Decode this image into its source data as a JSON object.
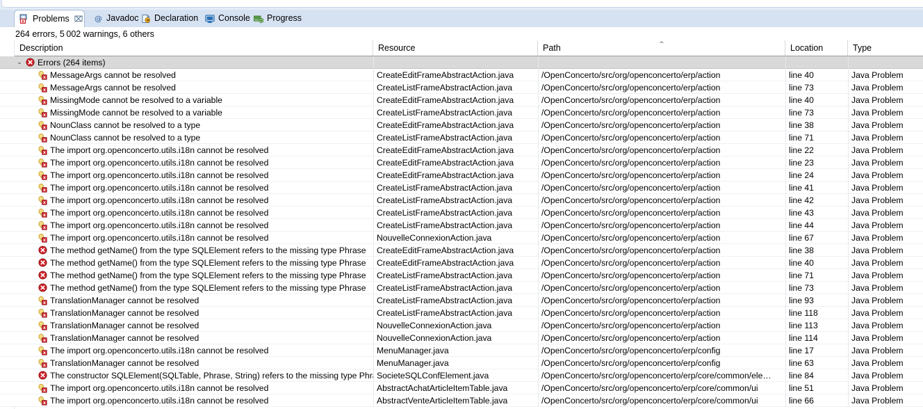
{
  "window": {
    "view_tabs": [
      {
        "label": "Problems",
        "icon": "problems-view-icon",
        "active": true,
        "close": "⌧"
      },
      {
        "label": "Javadoc",
        "icon": "javadoc-icon",
        "active": false
      },
      {
        "label": "Declaration",
        "icon": "declaration-icon",
        "active": false
      },
      {
        "label": "Console",
        "icon": "console-icon",
        "active": false
      },
      {
        "label": "Progress",
        "icon": "progress-icon",
        "active": false
      }
    ],
    "summary": "264 errors, 5 002 warnings, 6 others"
  },
  "table": {
    "columns": [
      {
        "key": "description",
        "label": "Description",
        "sorted": false
      },
      {
        "key": "resource",
        "label": "Resource",
        "sorted": false
      },
      {
        "key": "path",
        "label": "Path",
        "sorted": true,
        "sort_dir": "asc"
      },
      {
        "key": "location",
        "label": "Location",
        "sorted": false
      },
      {
        "key": "type",
        "label": "Type",
        "sorted": false
      }
    ],
    "group": {
      "label": "Errors (264 items)",
      "expanded": true,
      "twisty": "⌄",
      "icon": "error-icon"
    },
    "rows": [
      {
        "icon": "quickfix-error-icon",
        "description": "MessageArgs cannot be resolved",
        "resource": "CreateEditFrameAbstractAction.java",
        "path": "/OpenConcerto/src/org/openconcerto/erp/action",
        "location": "line 40",
        "type": "Java Problem"
      },
      {
        "icon": "quickfix-error-icon",
        "description": "MessageArgs cannot be resolved",
        "resource": "CreateListFrameAbstractAction.java",
        "path": "/OpenConcerto/src/org/openconcerto/erp/action",
        "location": "line 73",
        "type": "Java Problem"
      },
      {
        "icon": "quickfix-error-icon",
        "description": "MissingMode cannot be resolved to a variable",
        "resource": "CreateEditFrameAbstractAction.java",
        "path": "/OpenConcerto/src/org/openconcerto/erp/action",
        "location": "line 40",
        "type": "Java Problem"
      },
      {
        "icon": "quickfix-error-icon",
        "description": "MissingMode cannot be resolved to a variable",
        "resource": "CreateListFrameAbstractAction.java",
        "path": "/OpenConcerto/src/org/openconcerto/erp/action",
        "location": "line 73",
        "type": "Java Problem"
      },
      {
        "icon": "quickfix-error-icon",
        "description": "NounClass cannot be resolved to a type",
        "resource": "CreateEditFrameAbstractAction.java",
        "path": "/OpenConcerto/src/org/openconcerto/erp/action",
        "location": "line 38",
        "type": "Java Problem"
      },
      {
        "icon": "quickfix-error-icon",
        "description": "NounClass cannot be resolved to a type",
        "resource": "CreateListFrameAbstractAction.java",
        "path": "/OpenConcerto/src/org/openconcerto/erp/action",
        "location": "line 71",
        "type": "Java Problem"
      },
      {
        "icon": "quickfix-error-icon",
        "description": "The import org.openconcerto.utils.i18n cannot be resolved",
        "resource": "CreateEditFrameAbstractAction.java",
        "path": "/OpenConcerto/src/org/openconcerto/erp/action",
        "location": "line 22",
        "type": "Java Problem"
      },
      {
        "icon": "quickfix-error-icon",
        "description": "The import org.openconcerto.utils.i18n cannot be resolved",
        "resource": "CreateEditFrameAbstractAction.java",
        "path": "/OpenConcerto/src/org/openconcerto/erp/action",
        "location": "line 23",
        "type": "Java Problem"
      },
      {
        "icon": "quickfix-error-icon",
        "description": "The import org.openconcerto.utils.i18n cannot be resolved",
        "resource": "CreateEditFrameAbstractAction.java",
        "path": "/OpenConcerto/src/org/openconcerto/erp/action",
        "location": "line 24",
        "type": "Java Problem"
      },
      {
        "icon": "quickfix-error-icon",
        "description": "The import org.openconcerto.utils.i18n cannot be resolved",
        "resource": "CreateListFrameAbstractAction.java",
        "path": "/OpenConcerto/src/org/openconcerto/erp/action",
        "location": "line 41",
        "type": "Java Problem"
      },
      {
        "icon": "quickfix-error-icon",
        "description": "The import org.openconcerto.utils.i18n cannot be resolved",
        "resource": "CreateListFrameAbstractAction.java",
        "path": "/OpenConcerto/src/org/openconcerto/erp/action",
        "location": "line 42",
        "type": "Java Problem"
      },
      {
        "icon": "quickfix-error-icon",
        "description": "The import org.openconcerto.utils.i18n cannot be resolved",
        "resource": "CreateListFrameAbstractAction.java",
        "path": "/OpenConcerto/src/org/openconcerto/erp/action",
        "location": "line 43",
        "type": "Java Problem"
      },
      {
        "icon": "quickfix-error-icon",
        "description": "The import org.openconcerto.utils.i18n cannot be resolved",
        "resource": "CreateListFrameAbstractAction.java",
        "path": "/OpenConcerto/src/org/openconcerto/erp/action",
        "location": "line 44",
        "type": "Java Problem"
      },
      {
        "icon": "quickfix-error-icon",
        "description": "The import org.openconcerto.utils.i18n cannot be resolved",
        "resource": "NouvelleConnexionAction.java",
        "path": "/OpenConcerto/src/org/openconcerto/erp/action",
        "location": "line 67",
        "type": "Java Problem"
      },
      {
        "icon": "error-icon",
        "description": "The method getName() from the type SQLElement refers to the missing type Phrase",
        "resource": "CreateEditFrameAbstractAction.java",
        "path": "/OpenConcerto/src/org/openconcerto/erp/action",
        "location": "line 38",
        "type": "Java Problem"
      },
      {
        "icon": "error-icon",
        "description": "The method getName() from the type SQLElement refers to the missing type Phrase",
        "resource": "CreateEditFrameAbstractAction.java",
        "path": "/OpenConcerto/src/org/openconcerto/erp/action",
        "location": "line 40",
        "type": "Java Problem"
      },
      {
        "icon": "error-icon",
        "description": "The method getName() from the type SQLElement refers to the missing type Phrase",
        "resource": "CreateListFrameAbstractAction.java",
        "path": "/OpenConcerto/src/org/openconcerto/erp/action",
        "location": "line 71",
        "type": "Java Problem"
      },
      {
        "icon": "error-icon",
        "description": "The method getName() from the type SQLElement refers to the missing type Phrase",
        "resource": "CreateListFrameAbstractAction.java",
        "path": "/OpenConcerto/src/org/openconcerto/erp/action",
        "location": "line 73",
        "type": "Java Problem"
      },
      {
        "icon": "quickfix-error-icon",
        "description": "TranslationManager cannot be resolved",
        "resource": "CreateListFrameAbstractAction.java",
        "path": "/OpenConcerto/src/org/openconcerto/erp/action",
        "location": "line 93",
        "type": "Java Problem"
      },
      {
        "icon": "quickfix-error-icon",
        "description": "TranslationManager cannot be resolved",
        "resource": "CreateListFrameAbstractAction.java",
        "path": "/OpenConcerto/src/org/openconcerto/erp/action",
        "location": "line 118",
        "type": "Java Problem"
      },
      {
        "icon": "quickfix-error-icon",
        "description": "TranslationManager cannot be resolved",
        "resource": "NouvelleConnexionAction.java",
        "path": "/OpenConcerto/src/org/openconcerto/erp/action",
        "location": "line 113",
        "type": "Java Problem"
      },
      {
        "icon": "quickfix-error-icon",
        "description": "TranslationManager cannot be resolved",
        "resource": "NouvelleConnexionAction.java",
        "path": "/OpenConcerto/src/org/openconcerto/erp/action",
        "location": "line 114",
        "type": "Java Problem"
      },
      {
        "icon": "quickfix-error-icon",
        "description": "The import org.openconcerto.utils.i18n cannot be resolved",
        "resource": "MenuManager.java",
        "path": "/OpenConcerto/src/org/openconcerto/erp/config",
        "location": "line 17",
        "type": "Java Problem"
      },
      {
        "icon": "quickfix-error-icon",
        "description": "TranslationManager cannot be resolved",
        "resource": "MenuManager.java",
        "path": "/OpenConcerto/src/org/openconcerto/erp/config",
        "location": "line 63",
        "type": "Java Problem"
      },
      {
        "icon": "error-icon",
        "description": "The constructor SQLElement(SQLTable, Phrase, String) refers to the missing type Phrase",
        "resource": "SocieteSQLConfElement.java",
        "path": "/OpenConcerto/src/org/openconcerto/erp/core/common/ele…",
        "location": "line 84",
        "type": "Java Problem"
      },
      {
        "icon": "quickfix-error-icon",
        "description": "The import org.openconcerto.utils.i18n cannot be resolved",
        "resource": "AbstractAchatArticleItemTable.java",
        "path": "/OpenConcerto/src/org/openconcerto/erp/core/common/ui",
        "location": "line 51",
        "type": "Java Problem"
      },
      {
        "icon": "quickfix-error-icon",
        "description": "The import org.openconcerto.utils.i18n cannot be resolved",
        "resource": "AbstractVenteArticleItemTable.java",
        "path": "/OpenConcerto/src/org/openconcerto/erp/core/common/ui",
        "location": "line 66",
        "type": "Java Problem"
      }
    ]
  },
  "colors": {
    "tabbar_bg": "#d6e2f2",
    "error_red": "#cf2229",
    "group_row_bg": "#d9d9d9",
    "bulb_yellow": "#f5d56b"
  }
}
